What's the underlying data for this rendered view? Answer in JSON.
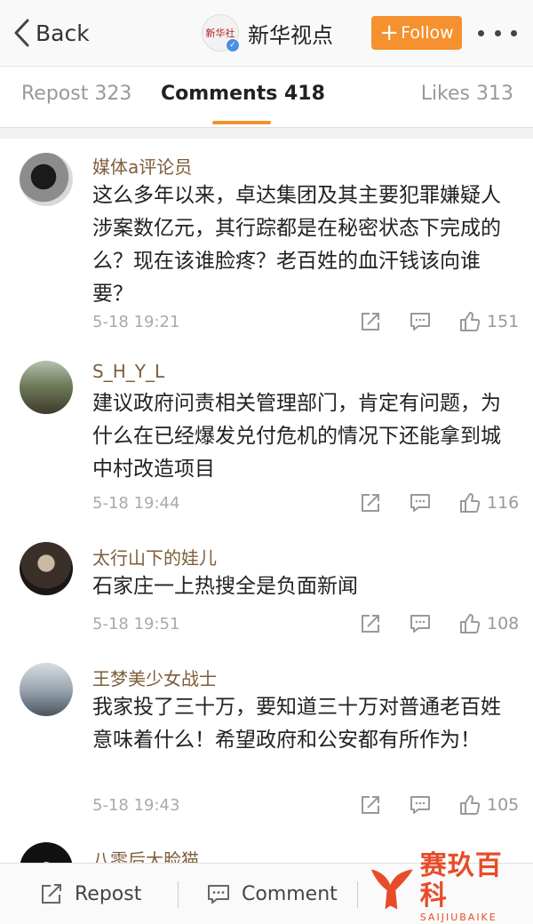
{
  "nav": {
    "back_label": "Back",
    "account_name": "新华视点",
    "logo_text": "新华社",
    "follow_label": "Follow",
    "follow_plus": "+"
  },
  "tabs": [
    {
      "label": "Repost 323"
    },
    {
      "label": "Comments 418",
      "active": true
    },
    {
      "label": "Likes 313"
    }
  ],
  "comments": [
    {
      "user": "媒体a评论员",
      "text": "这么多年以来，卓达集团及其主要犯罪嫌疑人涉案数亿元，其行踪都是在秘密状态下完成的么？现在该谁脸疼？老百姓的血汗钱该向谁要？",
      "time": "5-18 19:21",
      "likes": "151"
    },
    {
      "user": "S_H_Y_L",
      "text": "建议政府问责相关管理部门，肯定有问题，为什么在已经爆发兑付危机的情况下还能拿到城中村改造项目",
      "time": "5-18 19:44",
      "likes": "116"
    },
    {
      "user": "太行山下的娃儿",
      "text": "石家庄一上热搜全是负面新闻",
      "time": "5-18 19:51",
      "likes": "108"
    },
    {
      "user": "王梦美少女战士",
      "text": "我家投了三十万，要知道三十万对普通老百姓意味着什么！希望政府和公安都有所作为！",
      "time": "5-18 19:43",
      "likes": "105"
    },
    {
      "user": "八零后大脸猫"
    }
  ],
  "bottom_bar": {
    "repost_label": "Repost",
    "comment_label": "Comment"
  },
  "watermark": {
    "cn": "赛玖百科",
    "en": "SAIJIUBAIKE"
  },
  "colors": {
    "accent": "#f5912f",
    "username": "#7d5d3a",
    "muted": "#999999"
  }
}
